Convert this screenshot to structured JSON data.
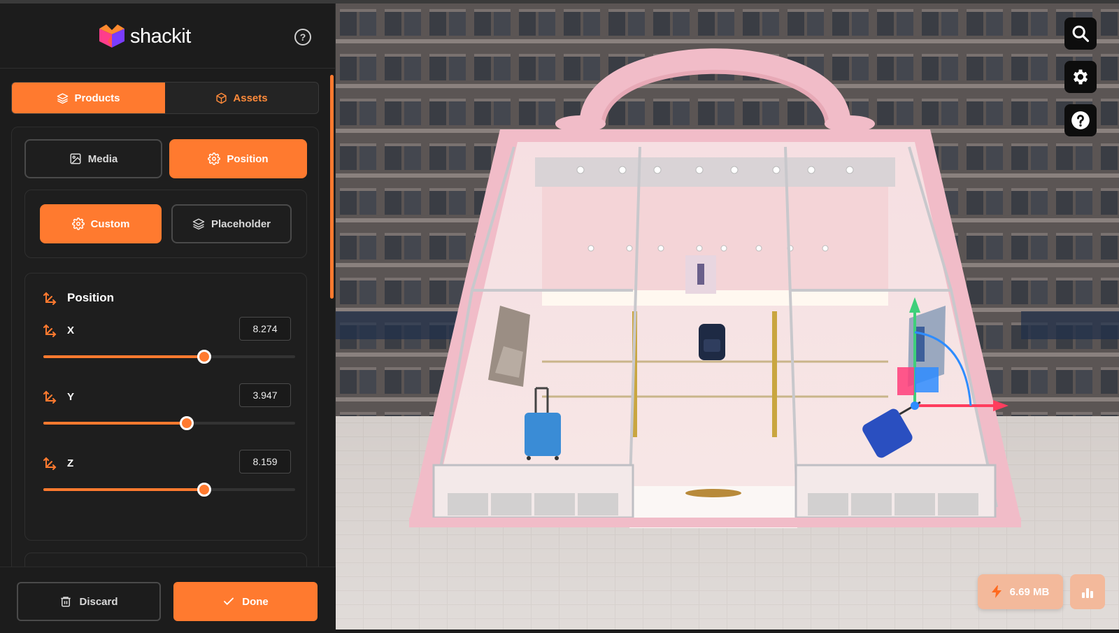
{
  "app": {
    "brand": "shackit"
  },
  "tabs": {
    "products": "Products",
    "assets": "Assets",
    "active": "products"
  },
  "subtabs": {
    "media": "Media",
    "position": "Position",
    "active": "position"
  },
  "mode": {
    "custom": "Custom",
    "placeholder": "Placeholder",
    "active": "custom"
  },
  "position": {
    "title": "Position",
    "axes": [
      {
        "label": "X",
        "value": "8.274",
        "fraction": 0.64
      },
      {
        "label": "Y",
        "value": "3.947",
        "fraction": 0.57
      },
      {
        "label": "Z",
        "value": "8.159",
        "fraction": 0.64
      }
    ]
  },
  "footer": {
    "discard": "Discard",
    "done": "Done"
  },
  "viewport": {
    "scene_size": "6.69 MB",
    "tools": [
      "search-icon",
      "gear-icon",
      "help-icon"
    ]
  },
  "colors": {
    "accent": "#ff7a2f",
    "sidebar_bg": "#1c1c1c",
    "scene_pink": "#f1bcc8"
  }
}
